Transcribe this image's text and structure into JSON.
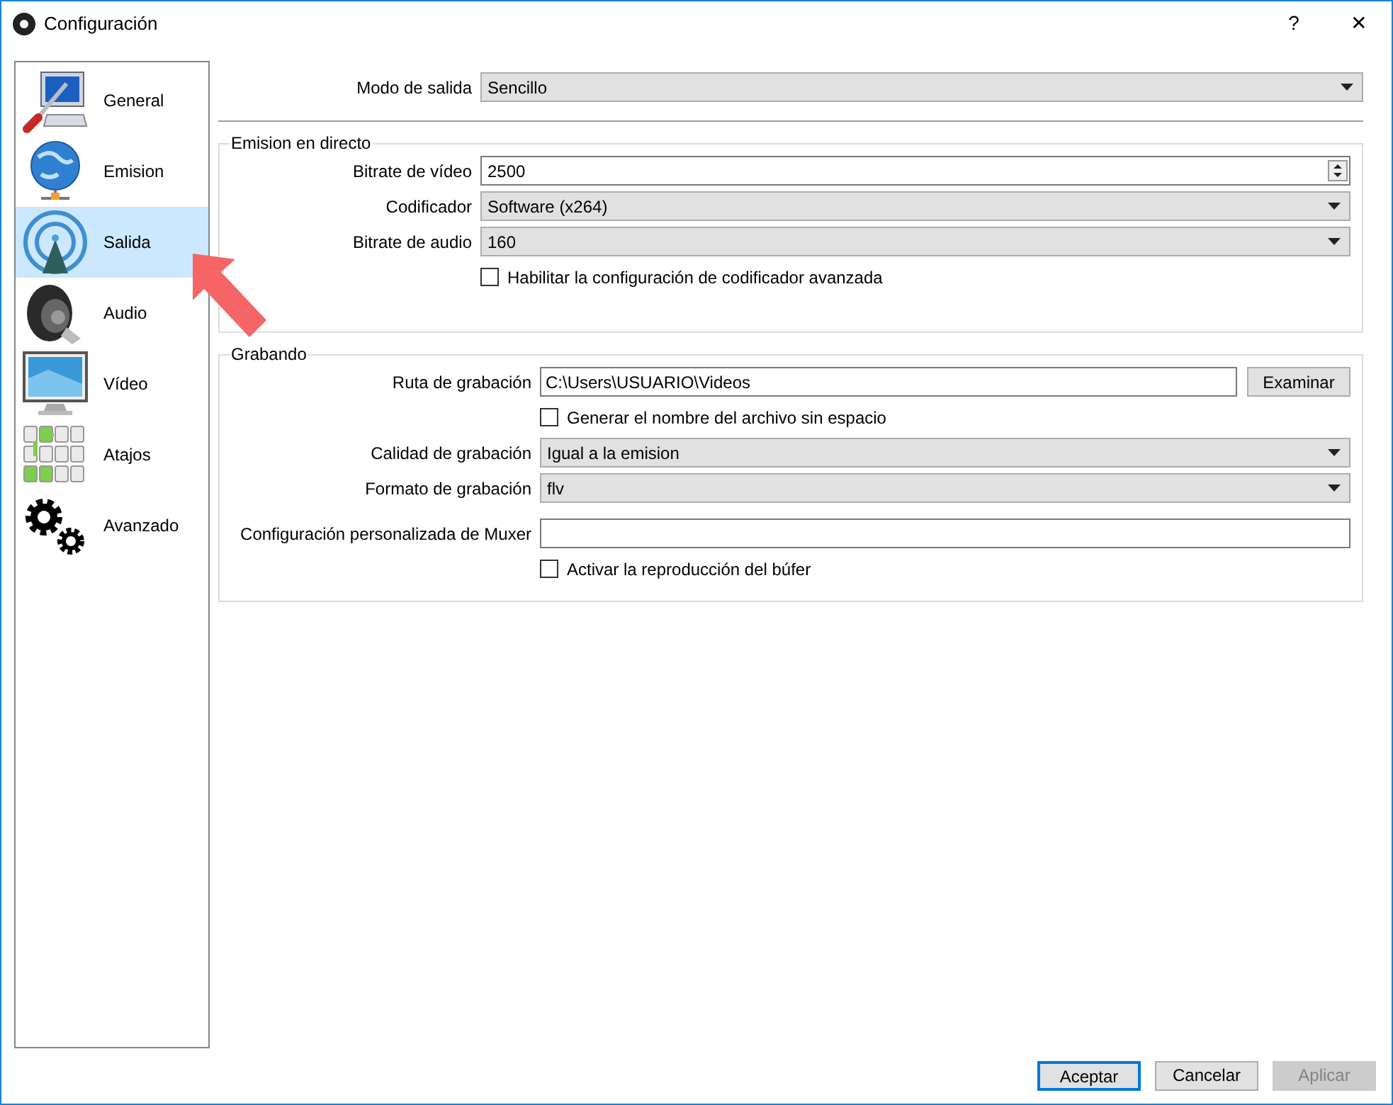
{
  "window": {
    "title": "Configuración",
    "help": "?",
    "close": "✕"
  },
  "sidebar": {
    "items": [
      {
        "label": "General",
        "selected": false
      },
      {
        "label": "Emision",
        "selected": false
      },
      {
        "label": "Salida",
        "selected": true
      },
      {
        "label": "Audio",
        "selected": false
      },
      {
        "label": "Vídeo",
        "selected": false
      },
      {
        "label": "Atajos",
        "selected": false
      },
      {
        "label": "Avanzado",
        "selected": false
      }
    ]
  },
  "output_mode": {
    "label": "Modo de salida",
    "value": "Sencillo"
  },
  "groups": [
    {
      "title": "Emision en directo",
      "rows": [
        {
          "kind": "spin",
          "label": "Bitrate de vídeo",
          "value": "2500"
        },
        {
          "kind": "select",
          "label": "Codificador",
          "value": "Software (x264)"
        },
        {
          "kind": "select",
          "label": "Bitrate de audio",
          "value": "160"
        },
        {
          "kind": "checkbox",
          "label": "Habilitar la configuración de codificador avanzada",
          "checked": false
        }
      ]
    },
    {
      "title": "Grabando",
      "rows": [
        {
          "kind": "path",
          "label": "Ruta de grabación",
          "value": "C:\\Users\\USUARIO\\Videos",
          "button": "Examinar"
        },
        {
          "kind": "checkbox",
          "label": "Generar el nombre del archivo sin espacio",
          "checked": false
        },
        {
          "kind": "select",
          "label": "Calidad de grabación",
          "value": "Igual a la emision"
        },
        {
          "kind": "select",
          "label": "Formato de grabación",
          "value": "flv"
        },
        {
          "kind": "text",
          "label": "Configuración personalizada de Muxer",
          "value": ""
        },
        {
          "kind": "checkbox",
          "label": "Activar la reproducción del búfer",
          "checked": false
        }
      ]
    }
  ],
  "buttons": [
    {
      "label": "Aceptar",
      "default": true,
      "disabled": false
    },
    {
      "label": "Cancelar",
      "default": false,
      "disabled": false
    },
    {
      "label": "Aplicar",
      "default": false,
      "disabled": true
    }
  ]
}
